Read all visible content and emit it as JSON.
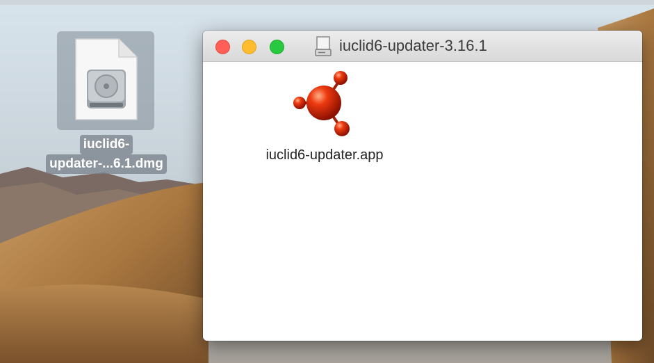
{
  "desktop": {
    "dmg_file": {
      "label_line1": "iuclid6-",
      "label_line2": "updater-...6.1.dmg",
      "icon": "disk-image-icon"
    }
  },
  "finder_window": {
    "title": "iuclid6-updater-3.16.1",
    "title_icon": "drive-icon",
    "buttons": {
      "close": "close-button",
      "minimize": "minimize-button",
      "zoom": "zoom-button"
    },
    "items": [
      {
        "label": "iuclid6-updater.app",
        "icon": "iuclid-molecule-icon"
      }
    ]
  },
  "colors": {
    "close": "#ff5f57",
    "minimize": "#febc2e",
    "zoom": "#28c840",
    "app_icon": "#d21a00"
  }
}
